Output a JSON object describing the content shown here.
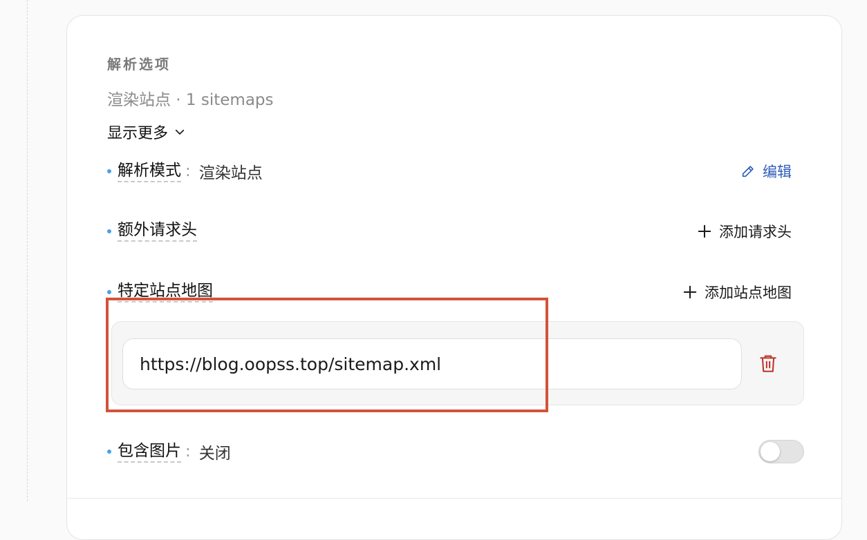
{
  "section": {
    "title": "解析选项",
    "summary": "渲染站点 · 1 sitemaps",
    "show_more": "显示更多"
  },
  "options": {
    "parse_mode": {
      "label": "解析模式",
      "colon": ":",
      "value": "渲染站点",
      "action": "编辑"
    },
    "extra_headers": {
      "label": "额外请求头",
      "action": "添加请求头"
    },
    "sitemaps": {
      "label": "特定站点地图",
      "action": "添加站点地图",
      "items": [
        {
          "url": "https://blog.oopss.top/sitemap.xml"
        }
      ]
    },
    "include_images": {
      "label": "包含图片",
      "colon": ":",
      "value": "关闭",
      "toggle_on": false
    }
  },
  "icons": {
    "show_more": "chevron-down-icon",
    "edit": "pencil-icon",
    "add": "plus-icon",
    "delete": "trash-icon"
  },
  "colors": {
    "bullet": "#4a9fe8",
    "edit_link": "#2d5bb8",
    "delete_icon": "#c0302b",
    "highlight": "#d2533a"
  }
}
